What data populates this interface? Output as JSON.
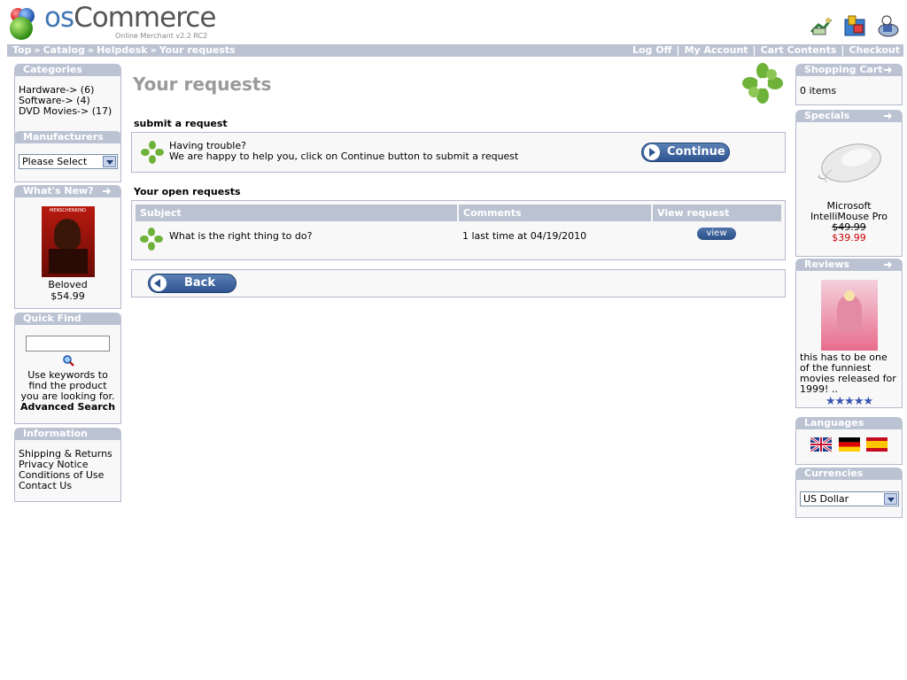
{
  "header": {
    "logo_os": "os",
    "logo_commerce": "Commerce",
    "logo_sub": "Online Merchant v2.2 RC2",
    "icons": [
      "my-account-icon",
      "cart-contents-icon",
      "checkout-icon"
    ]
  },
  "breadcrumb": [
    "Top",
    "Catalog",
    "Helpdesk",
    "Your requests"
  ],
  "breadcrumb_sep": "»",
  "toplinks": [
    "Log Off",
    "My Account",
    "Cart Contents",
    "Checkout"
  ],
  "categories": {
    "title": "Categories",
    "items": [
      "Hardware-> (6)",
      "Software-> (4)",
      "DVD Movies-> (17)"
    ]
  },
  "manufacturers": {
    "title": "Manufacturers",
    "select_value": "Please Select"
  },
  "whats_new": {
    "title": "What's New?",
    "poster_title": "MENSCHENKIND",
    "product": "Beloved",
    "price": "$54.99"
  },
  "quick_find": {
    "title": "Quick Find",
    "input_value": "",
    "help": "Use keywords to find the product you are looking for.",
    "advanced": "Advanced Search"
  },
  "information": {
    "title": "Information",
    "items": [
      "Shipping & Returns",
      "Privacy Notice",
      "Conditions of Use",
      "Contact Us"
    ]
  },
  "main": {
    "title": "Your requests",
    "submit_heading": "submit a request",
    "submit_line1": "Having trouble?",
    "submit_line2": "We are happy to help you, click on Continue button to submit a request",
    "continue_label": "Continue",
    "open_heading": "Your open requests",
    "columns": [
      "Subject",
      "Comments",
      "View request"
    ],
    "rows": [
      {
        "subject": "What is the right thing to do?",
        "comments": "1 last time at 04/19/2010",
        "view": "view"
      }
    ],
    "back_label": "Back"
  },
  "shopping_cart": {
    "title": "Shopping Cart",
    "text": "0 items"
  },
  "specials": {
    "title": "Specials",
    "product_line1": "Microsoft",
    "product_line2": "IntelliMouse Pro",
    "old_price": "$49.99",
    "new_price": "$39.99"
  },
  "reviews": {
    "title": "Reviews",
    "text": "this has to be one of the funniest movies released for 1999! ..",
    "stars": "★★★★★",
    "rating": 5
  },
  "languages": {
    "title": "Languages",
    "flags": [
      "english-flag",
      "german-flag",
      "spanish-flag"
    ]
  },
  "currencies": {
    "title": "Currencies",
    "select_value": "US Dollar"
  },
  "colors": {
    "accent": "#bbc3d3",
    "box_bg": "#f8f8f9",
    "button": "#2f5591",
    "price_red": "#cc0000"
  }
}
